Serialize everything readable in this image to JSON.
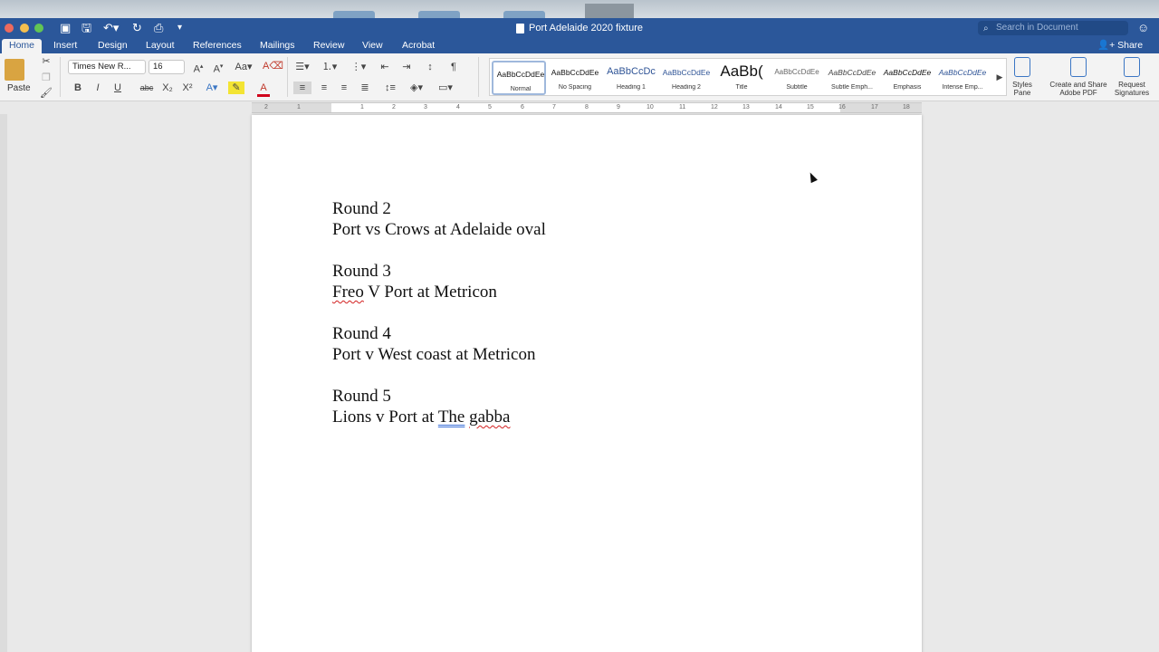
{
  "window": {
    "title": "Port Adelaide 2020 fixture",
    "search_placeholder": "Search in Document"
  },
  "tabs": [
    "Home",
    "Insert",
    "Design",
    "Layout",
    "References",
    "Mailings",
    "Review",
    "View",
    "Acrobat"
  ],
  "share_label": "Share",
  "ribbon": {
    "paste_label": "Paste",
    "font_name": "Times New R...",
    "font_size": "16",
    "styles": [
      {
        "sample": "AaBbCcDdEe",
        "name": "Normal"
      },
      {
        "sample": "AaBbCcDdEe",
        "name": "No Spacing"
      },
      {
        "sample": "AaBbCcDc",
        "name": "Heading 1"
      },
      {
        "sample": "AaBbCcDdEe",
        "name": "Heading 2"
      },
      {
        "sample": "AaBb(",
        "name": "Title"
      },
      {
        "sample": "AaBbCcDdEe",
        "name": "Subtitle"
      },
      {
        "sample": "AaBbCcDdEe",
        "name": "Subtle Emph..."
      },
      {
        "sample": "AaBbCcDdEe",
        "name": "Emphasis"
      },
      {
        "sample": "AaBbCcDdEe",
        "name": "Intense Emp..."
      }
    ],
    "styles_pane": "Styles Pane",
    "create_share_pdf": "Create and Share Adobe PDF",
    "request_signatures": "Request Signatures"
  },
  "ruler_numbers": [
    "2",
    "1",
    "1",
    "2",
    "3",
    "4",
    "5",
    "6",
    "7",
    "8",
    "9",
    "10",
    "11",
    "12",
    "13",
    "14",
    "15",
    "16",
    "17",
    "18"
  ],
  "document": {
    "rounds": [
      {
        "round": "Round 2",
        "match": "Port vs Crows at Adelaide oval"
      },
      {
        "round": "Round 3",
        "match_parts": [
          "Freo",
          " V Port at Metricon"
        ]
      },
      {
        "round": "Round 4",
        "match": "Port v West coast at Metricon"
      },
      {
        "round": "Round 5",
        "match_parts": [
          "Lions v Port at ",
          "The",
          " ",
          "gabba"
        ]
      }
    ]
  }
}
